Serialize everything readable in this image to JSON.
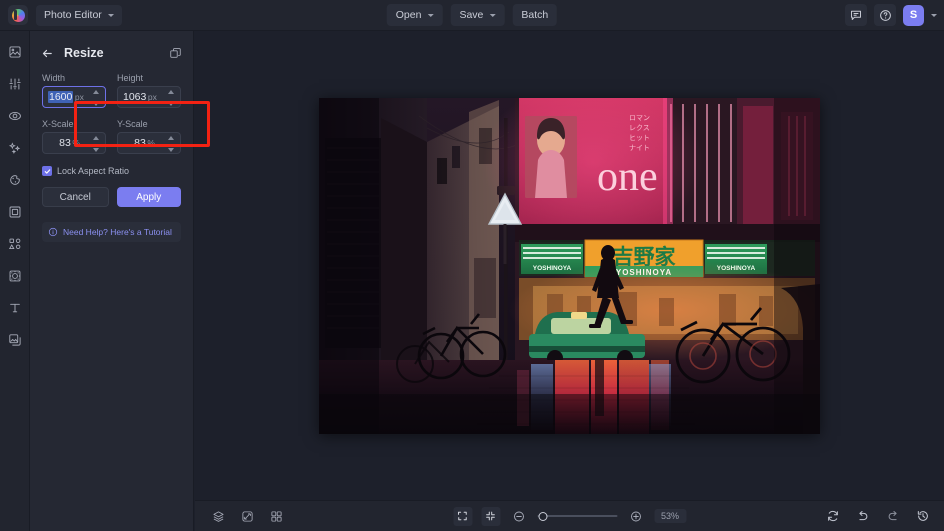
{
  "app": {
    "product_menu": "Photo Editor",
    "logo": "pixlr-logo-icon"
  },
  "topbar": {
    "open_label": "Open",
    "save_label": "Save",
    "batch_label": "Batch",
    "feedback_icon": "comment-icon",
    "help_icon": "question-circle-icon",
    "avatar_initial": "S",
    "avatar_color": "#7b7df0"
  },
  "rail": {
    "items": [
      {
        "name": "arrange-icon",
        "label": "Arrange"
      },
      {
        "name": "adjust-icon",
        "label": "Adjust"
      },
      {
        "name": "effects-icon",
        "label": "Effects"
      },
      {
        "name": "retouch-icon",
        "label": "Retouch"
      },
      {
        "name": "liquify-icon",
        "label": "Liquify"
      },
      {
        "name": "crop-frame-icon",
        "label": "Crop"
      },
      {
        "name": "shapes-icon",
        "label": "Shapes"
      },
      {
        "name": "sticker-icon",
        "label": "Stickers"
      },
      {
        "name": "text-icon",
        "label": "Text"
      },
      {
        "name": "watermark-icon",
        "label": "Add image"
      }
    ]
  },
  "panel": {
    "back_icon": "arrow-left-icon",
    "title": "Resize",
    "header_action_icon": "crop-resize-icon",
    "width": {
      "label": "Width",
      "value": "1600",
      "unit": "px",
      "selected": true,
      "focused": true
    },
    "height": {
      "label": "Height",
      "value": "1063",
      "unit": "px"
    },
    "x_scale": {
      "label": "X-Scale",
      "value": "83",
      "unit": "%"
    },
    "y_scale": {
      "label": "Y-Scale",
      "value": "83",
      "unit": "%"
    },
    "lock_aspect": {
      "label": "Lock Aspect Ratio",
      "checked": true
    },
    "cancel_label": "Cancel",
    "apply_label": "Apply",
    "help_text": "Need Help? Here's a Tutorial",
    "help_icon": "info-circle-icon",
    "highlight_color": "#f32213"
  },
  "bottombar": {
    "left_icons": [
      {
        "name": "layers-icon"
      },
      {
        "name": "link-broken-icon"
      },
      {
        "name": "grid-icon"
      }
    ],
    "fit_screen_icon": "fit-screen-icon",
    "actual-size_icon": "collapse-screen-icon",
    "zoom_out_icon": "zoom-out-icon",
    "zoom_in_icon": "zoom-in-icon",
    "zoom_value": "53%",
    "zoom_slider_percent": 3,
    "right_icons": [
      {
        "name": "reset-icon"
      },
      {
        "name": "undo-icon"
      },
      {
        "name": "redo-icon"
      },
      {
        "name": "history-icon"
      }
    ]
  },
  "canvas": {
    "image_name": "night-street-neon-photo",
    "image_description": "Night city street with neon signs, Yoshinoya storefront, bicycles and wet reflective pavement",
    "signs": {
      "pink_billboard": "one",
      "green_sign_jp": "吉野家",
      "green_sign_en": "YOSHINOYA",
      "side_left": "YOSHINOYA",
      "side_right": "YOSHINOYA"
    }
  }
}
